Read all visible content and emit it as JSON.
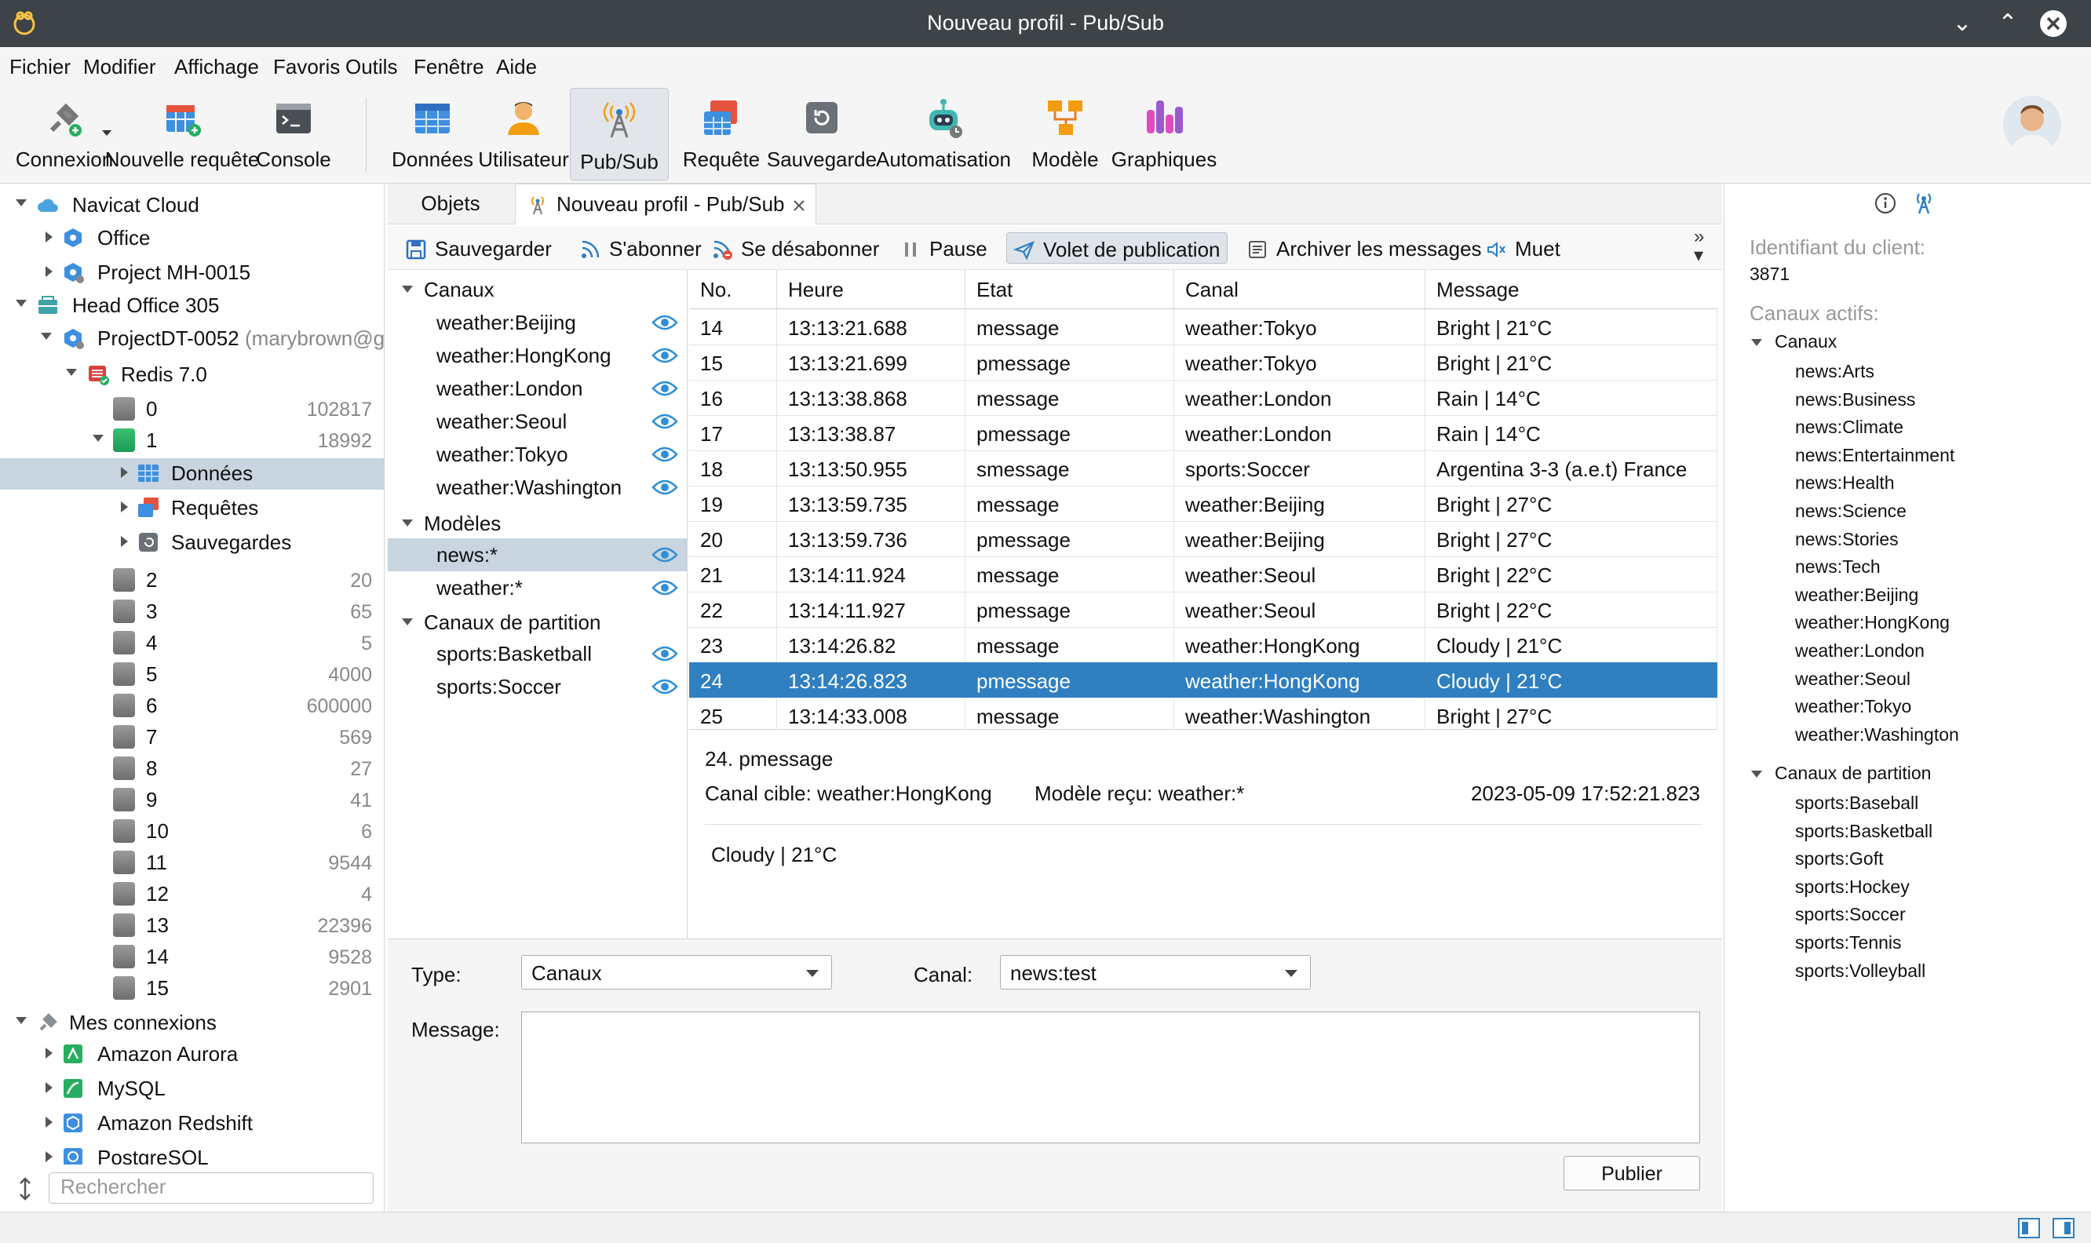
{
  "window": {
    "title": "Nouveau profil - Pub/Sub"
  },
  "menu": [
    "Fichier",
    "Modifier",
    "Affichage",
    "Favoris",
    "Outils",
    "Fenêtre",
    "Aide"
  ],
  "toolbar": {
    "connexion": "Connexion",
    "nouvelle_requete": "Nouvelle requête",
    "console": "Console",
    "donnees": "Données",
    "utilisateur": "Utilisateur",
    "pubsub": "Pub/Sub",
    "requete": "Requête",
    "sauvegarde": "Sauvegarde",
    "automatisation": "Automatisation",
    "modele": "Modèle",
    "graphiques": "Graphiques"
  },
  "tree": {
    "navicat_cloud": "Navicat Cloud",
    "office": "Office",
    "project_mh": "Project MH-0015",
    "head_office": "Head Office 305",
    "project_dt": "ProjectDT-0052",
    "project_dt_owner": "(marybrown@g",
    "redis": "Redis 7.0",
    "db0": {
      "name": "0",
      "count": "102817"
    },
    "db1": {
      "name": "1",
      "count": "18992"
    },
    "donnees": "Données",
    "requetes": "Requêtes",
    "sauvegardes": "Sauvegardes",
    "dbs": [
      {
        "name": "2",
        "count": "20"
      },
      {
        "name": "3",
        "count": "65"
      },
      {
        "name": "4",
        "count": "5"
      },
      {
        "name": "5",
        "count": "4000"
      },
      {
        "name": "6",
        "count": "600000"
      },
      {
        "name": "7",
        "count": "569"
      },
      {
        "name": "8",
        "count": "27"
      },
      {
        "name": "9",
        "count": "41"
      },
      {
        "name": "10",
        "count": "6"
      },
      {
        "name": "11",
        "count": "9544"
      },
      {
        "name": "12",
        "count": "4"
      },
      {
        "name": "13",
        "count": "22396"
      },
      {
        "name": "14",
        "count": "9528"
      },
      {
        "name": "15",
        "count": "2901"
      }
    ],
    "mes_connexions": "Mes connexions",
    "conns": [
      "Amazon Aurora",
      "MySQL",
      "Amazon Redshift",
      "PostgreSQL"
    ]
  },
  "search": {
    "placeholder": "Rechercher"
  },
  "tabs": {
    "objets": "Objets",
    "active": "Nouveau profil - Pub/Sub"
  },
  "subtoolbar": {
    "sauvegarder": "Sauvegarder",
    "abonner": "S'abonner",
    "desabonner": "Se désabonner",
    "pause": "Pause",
    "volet": "Volet de publication",
    "archiver": "Archiver les messages",
    "muet": "Muet"
  },
  "channels": {
    "canaux_label": "Canaux",
    "canaux": [
      "weather:Beijing",
      "weather:HongKong",
      "weather:London",
      "weather:Seoul",
      "weather:Tokyo",
      "weather:Washington"
    ],
    "modeles_label": "Modèles",
    "modeles": [
      "news:*",
      "weather:*"
    ],
    "partition_label": "Canaux de partition",
    "partition": [
      "sports:Basketball",
      "sports:Soccer"
    ]
  },
  "table": {
    "headers": [
      "No.",
      "Heure",
      "Etat",
      "Canal",
      "Message"
    ],
    "rows": [
      [
        "14",
        "13:13:21.688",
        "message",
        "weather:Tokyo",
        "Bright | 21°C"
      ],
      [
        "15",
        "13:13:21.699",
        "pmessage",
        "weather:Tokyo",
        "Bright | 21°C"
      ],
      [
        "16",
        "13:13:38.868",
        "message",
        "weather:London",
        "Rain | 14°C"
      ],
      [
        "17",
        "13:13:38.87",
        "pmessage",
        "weather:London",
        "Rain | 14°C"
      ],
      [
        "18",
        "13:13:50.955",
        "smessage",
        "sports:Soccer",
        "Argentina 3-3 (a.e.t) France"
      ],
      [
        "19",
        "13:13:59.735",
        "message",
        "weather:Beijing",
        "Bright | 27°C"
      ],
      [
        "20",
        "13:13:59.736",
        "pmessage",
        "weather:Beijing",
        "Bright | 27°C"
      ],
      [
        "21",
        "13:14:11.924",
        "message",
        "weather:Seoul",
        "Bright | 22°C"
      ],
      [
        "22",
        "13:14:11.927",
        "pmessage",
        "weather:Seoul",
        "Bright | 22°C"
      ],
      [
        "23",
        "13:14:26.82",
        "message",
        "weather:HongKong",
        "Cloudy | 21°C"
      ],
      [
        "24",
        "13:14:26.823",
        "pmessage",
        "weather:HongKong",
        "Cloudy | 21°C"
      ],
      [
        "25",
        "13:14:33.008",
        "message",
        "weather:Washington",
        "Bright | 27°C"
      ]
    ]
  },
  "detail": {
    "heading": "24. pmessage",
    "canal": "Canal cible: weather:HongKong",
    "modele": "Modèle reçu: weather:*",
    "date": "2023-05-09 17:52:21.823",
    "body": "Cloudy | 21°C"
  },
  "publish": {
    "type_label": "Type:",
    "type_value": "Canaux",
    "canal_label": "Canal:",
    "canal_value": "news:test",
    "message_label": "Message:",
    "publier": "Publier"
  },
  "right": {
    "client_label": "Identifiant du client:",
    "client_id": "3871",
    "actifs_label": "Canaux actifs:",
    "canaux_label": "Canaux",
    "canaux": [
      "news:Arts",
      "news:Business",
      "news:Climate",
      "news:Entertainment",
      "news:Health",
      "news:Science",
      "news:Stories",
      "news:Tech",
      "weather:Beijing",
      "weather:HongKong",
      "weather:London",
      "weather:Seoul",
      "weather:Tokyo",
      "weather:Washington"
    ],
    "partition_label": "Canaux de partition",
    "partition": [
      "sports:Baseball",
      "sports:Basketball",
      "sports:Goft",
      "sports:Hockey",
      "sports:Soccer",
      "sports:Tennis",
      "sports:Volleyball"
    ]
  },
  "colors": {
    "accent": "#2f7fc1",
    "titlebar": "#3e4347",
    "selection": "#c8d4df"
  }
}
